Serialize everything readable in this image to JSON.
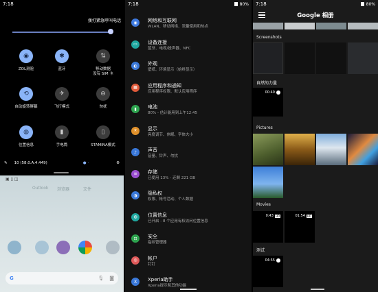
{
  "panel1": {
    "status": {
      "time": "7:18"
    },
    "emergency_call": "拨打紧急呼叫电话",
    "tiles": [
      {
        "label": "ZOL测验",
        "icon": "wifi-icon",
        "glyph": "◉",
        "on": true
      },
      {
        "label": "蓝牙",
        "icon": "bluetooth-icon",
        "glyph": "✱",
        "on": true
      },
      {
        "label": "移动数据\n没有 SIM 卡",
        "icon": "mobile-data-icon",
        "glyph": "⇅",
        "on": false
      },
      {
        "label": "自动旋转屏幕",
        "icon": "auto-rotate-icon",
        "glyph": "⟲",
        "on": true
      },
      {
        "label": "飞行模式",
        "icon": "airplane-icon",
        "glyph": "✈",
        "on": false
      },
      {
        "label": "勿扰",
        "icon": "do-not-disturb-icon",
        "glyph": "⊖",
        "on": false
      },
      {
        "label": "位置信息",
        "icon": "location-icon",
        "glyph": "◍",
        "on": true
      },
      {
        "label": "手电筒",
        "icon": "flashlight-icon",
        "glyph": "▮",
        "on": false
      },
      {
        "label": "STAMINA模式",
        "icon": "stamina-icon",
        "glyph": "▯",
        "on": false
      }
    ],
    "build": "10 (58.0.A.4.449)",
    "home_apps": [
      "Outlook",
      "浏览器",
      "文件"
    ],
    "colors": {
      "tile_on": "#8ab4f8",
      "tile_off": "#3c3c3c"
    }
  },
  "panel2": {
    "status": {
      "time": "7:18",
      "battery": "80%"
    },
    "items": [
      {
        "title": "网络和互联网",
        "subtitle": "WLAN、移动网络、流量使用和热点",
        "icon": "wifi-icon",
        "glyph": "◉",
        "color": "#3f7be0"
      },
      {
        "title": "设备连接",
        "subtitle": "蓝牙、电视/投声器、NFC",
        "icon": "devices-icon",
        "glyph": "▭",
        "color": "#20a8a0"
      },
      {
        "title": "外观",
        "subtitle": "壁纸、环境显示（始终显示）",
        "icon": "appearance-icon",
        "glyph": "◐",
        "color": "#3a78d8"
      },
      {
        "title": "应用程序和通知",
        "subtitle": "应用程序权限、默认应用程序",
        "icon": "apps-icon",
        "glyph": "▦",
        "color": "#e05a3a"
      },
      {
        "title": "电池",
        "subtitle": "80% - 估计能用到上午12:45",
        "icon": "battery-icon",
        "glyph": "▮",
        "color": "#2ea44f"
      },
      {
        "title": "显示",
        "subtitle": "亮度调节、休眠、字体大小",
        "icon": "display-icon",
        "glyph": "☀",
        "color": "#e0902a"
      },
      {
        "title": "声音",
        "subtitle": "音量、铃声、勿扰",
        "icon": "sound-icon",
        "glyph": "♪",
        "color": "#3a78d8"
      },
      {
        "title": "存储",
        "subtitle": "已使用 13% - 还剩 221 GB",
        "icon": "storage-icon",
        "glyph": "≡",
        "color": "#9b4fd0"
      },
      {
        "title": "隐私权",
        "subtitle": "权限、帐号活动、个人数据",
        "icon": "privacy-icon",
        "glyph": "◑",
        "color": "#3a78d8"
      },
      {
        "title": "位置信息",
        "subtitle": "已开启 - 8 个应用有权访问位置信息",
        "icon": "location-icon",
        "glyph": "◍",
        "color": "#20a8a0"
      },
      {
        "title": "安全",
        "subtitle": "指纹管理器",
        "icon": "security-icon",
        "glyph": "⊡",
        "color": "#2ea44f"
      },
      {
        "title": "帐户",
        "subtitle": "钉钉",
        "icon": "account-icon",
        "glyph": "◎",
        "color": "#e05a5a"
      },
      {
        "title": "Xperia助手",
        "subtitle": "Xperia提示和其他功能",
        "icon": "xperia-icon",
        "glyph": "X",
        "color": "#3a78d8"
      }
    ]
  },
  "panel3": {
    "status": {
      "time": "7:18",
      "battery": "80%"
    },
    "title": "Google 相册",
    "sections": {
      "screenshots": "Screenshots",
      "nature": "自然的力量",
      "pictures": "Pictures",
      "movies": "Movies",
      "test": "测试"
    },
    "durations": {
      "nature": "00:49",
      "movie1": "0:43",
      "movie2": "01:54",
      "test": "04:55"
    }
  }
}
